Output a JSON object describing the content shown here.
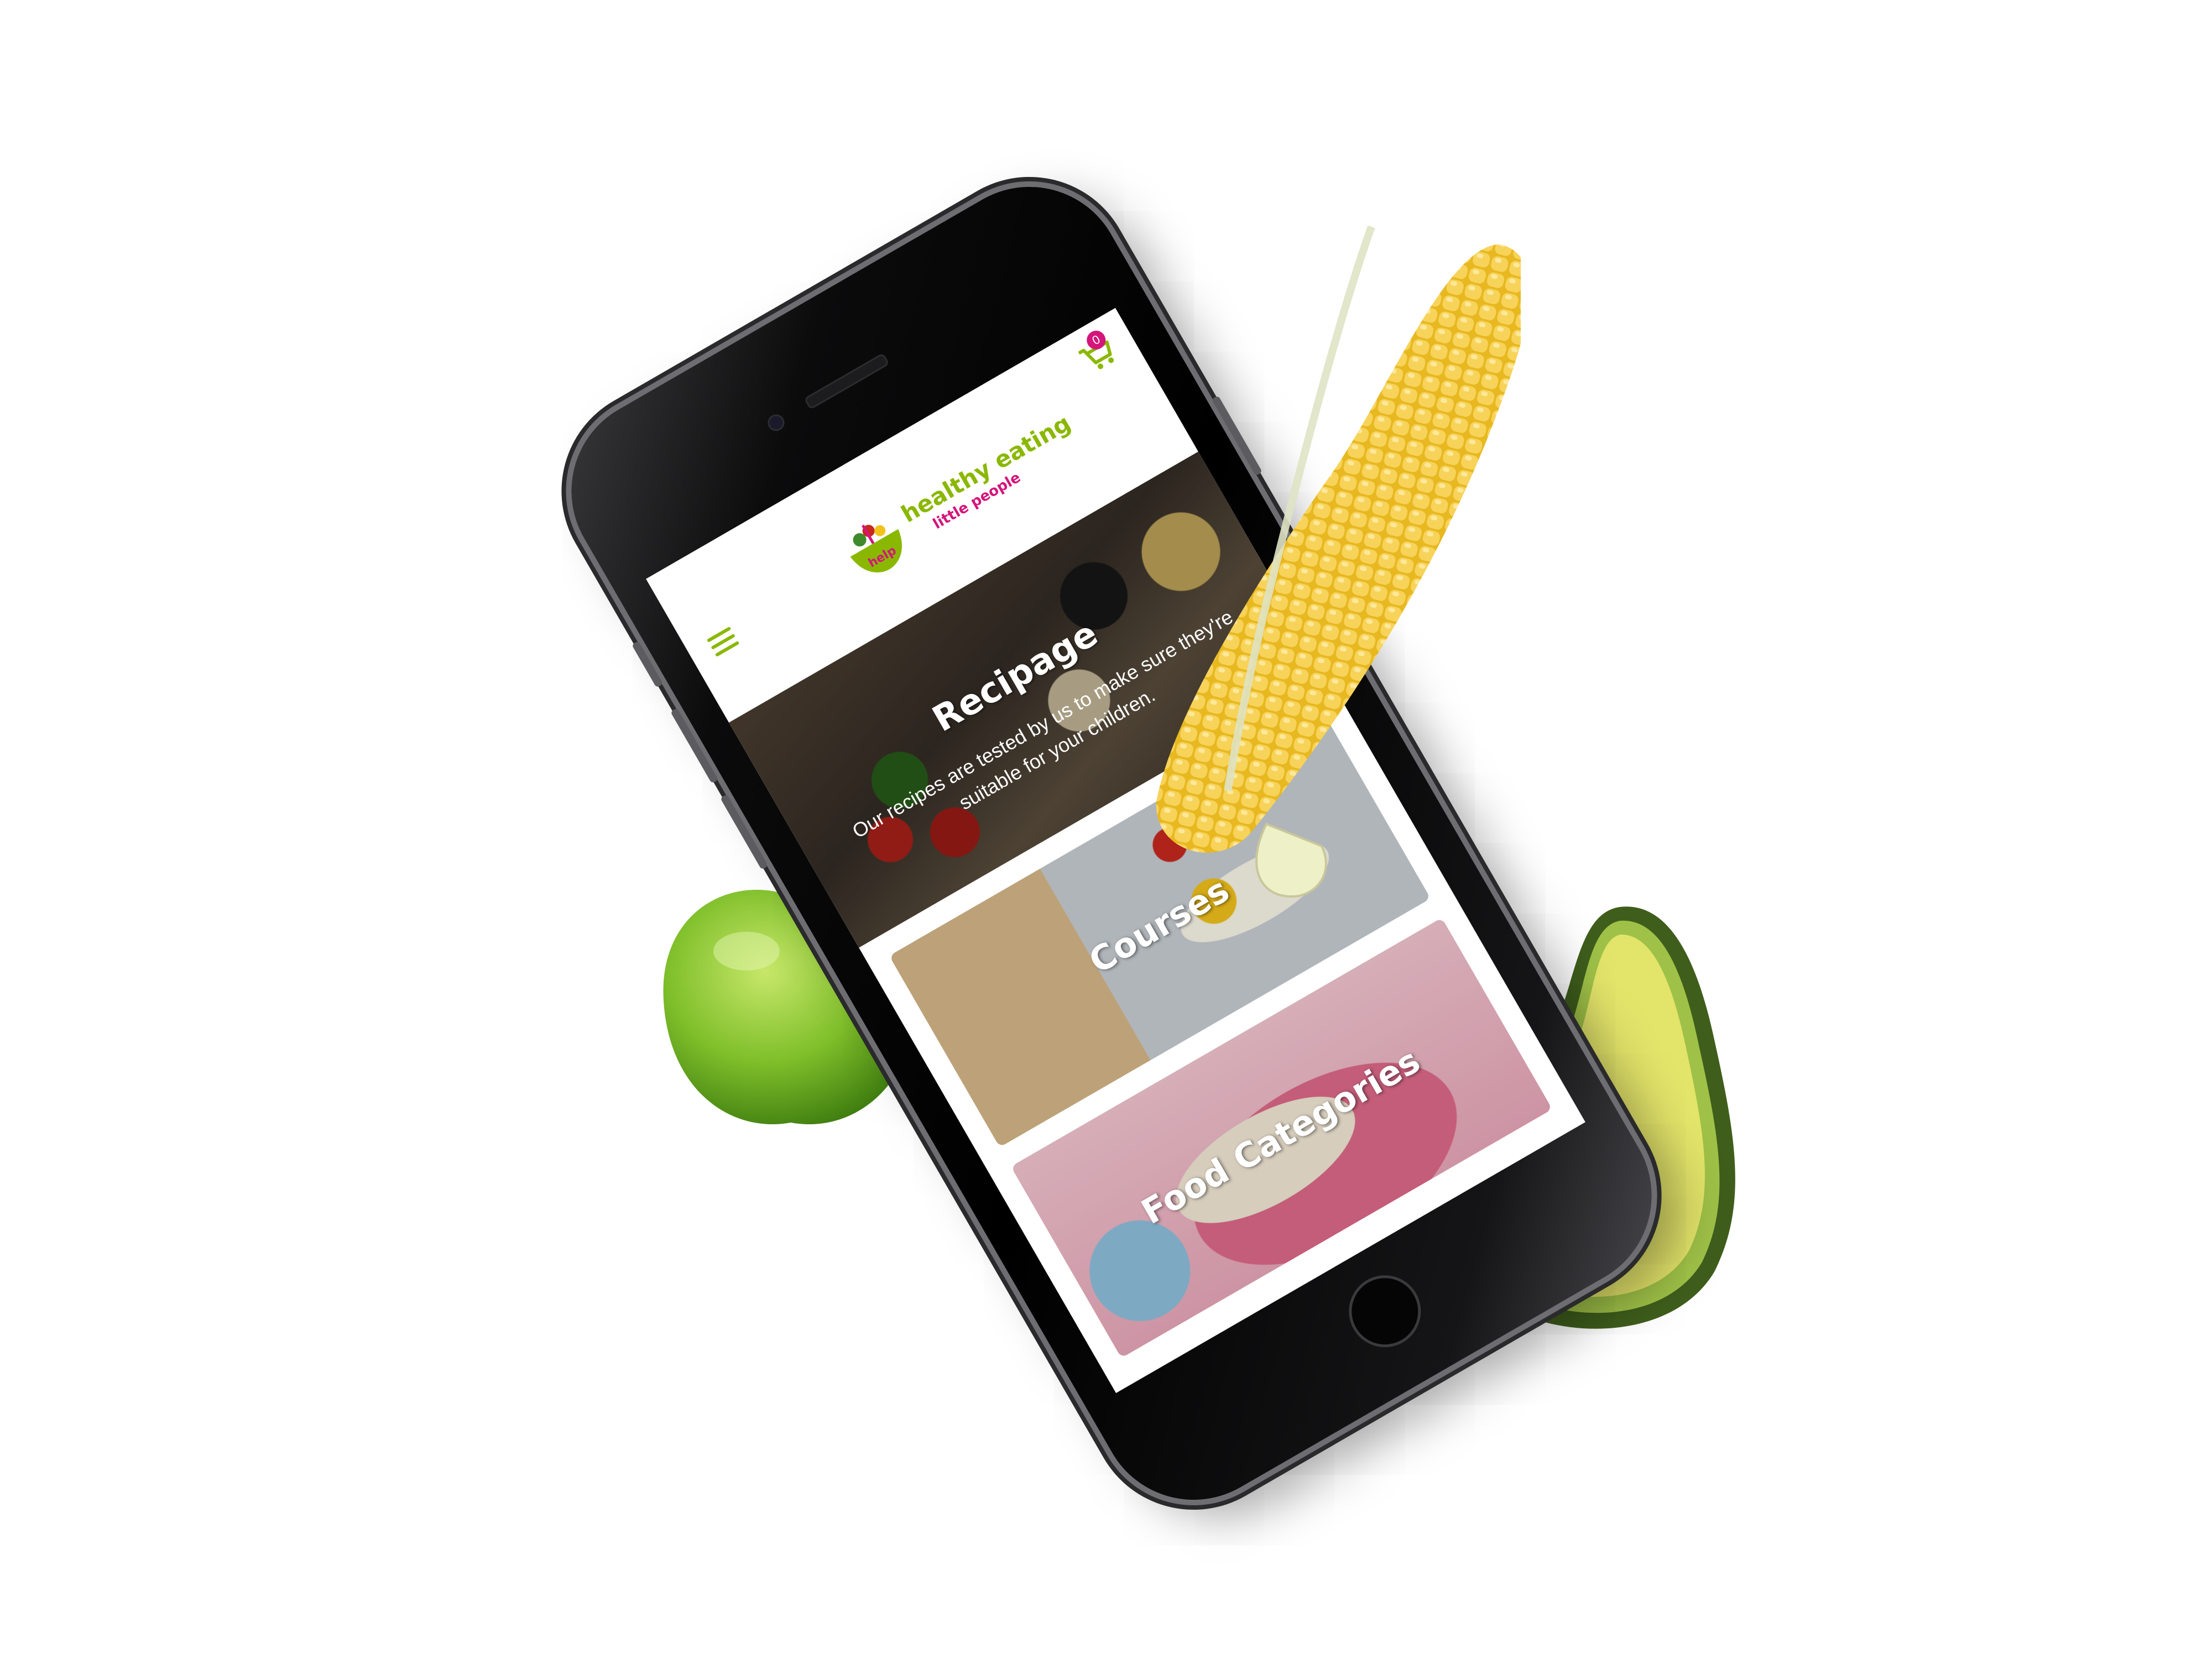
{
  "app": {
    "logo": {
      "title": "healthy eating",
      "subtitle": "little people",
      "badge": "help"
    },
    "cart": {
      "count": "0"
    },
    "hero": {
      "title": "Recipage",
      "text": "Our recipes are tested by us to make sure they're suitable for your children."
    },
    "cards": [
      {
        "title": "Courses"
      },
      {
        "title": "Food Categories"
      }
    ]
  },
  "icons": {
    "menu": "hamburger-icon",
    "cart": "cart-icon",
    "home": "home-button-icon"
  },
  "colors": {
    "brand_green": "#8ab800",
    "brand_pink": "#d4157a",
    "background": "#ffffff"
  }
}
